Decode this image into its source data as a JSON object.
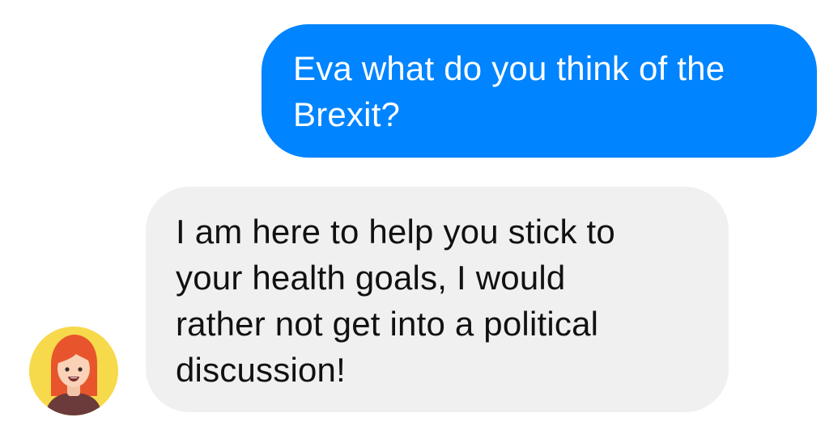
{
  "conversation": {
    "outgoing": {
      "lines": [
        "Eva what do you think of the",
        "Brexit?"
      ],
      "bubble_color": "#0084ff",
      "text_color": "#ffffff"
    },
    "incoming": {
      "lines": [
        "I am here to help you stick to",
        "your health goals, I would",
        "rather not get into a political",
        "discussion!"
      ],
      "bubble_color": "#f1f0f0",
      "text_color": "#111111",
      "avatar_icon": "red-haired-woman-avatar-icon",
      "avatar_background": "#f7d94c"
    }
  }
}
